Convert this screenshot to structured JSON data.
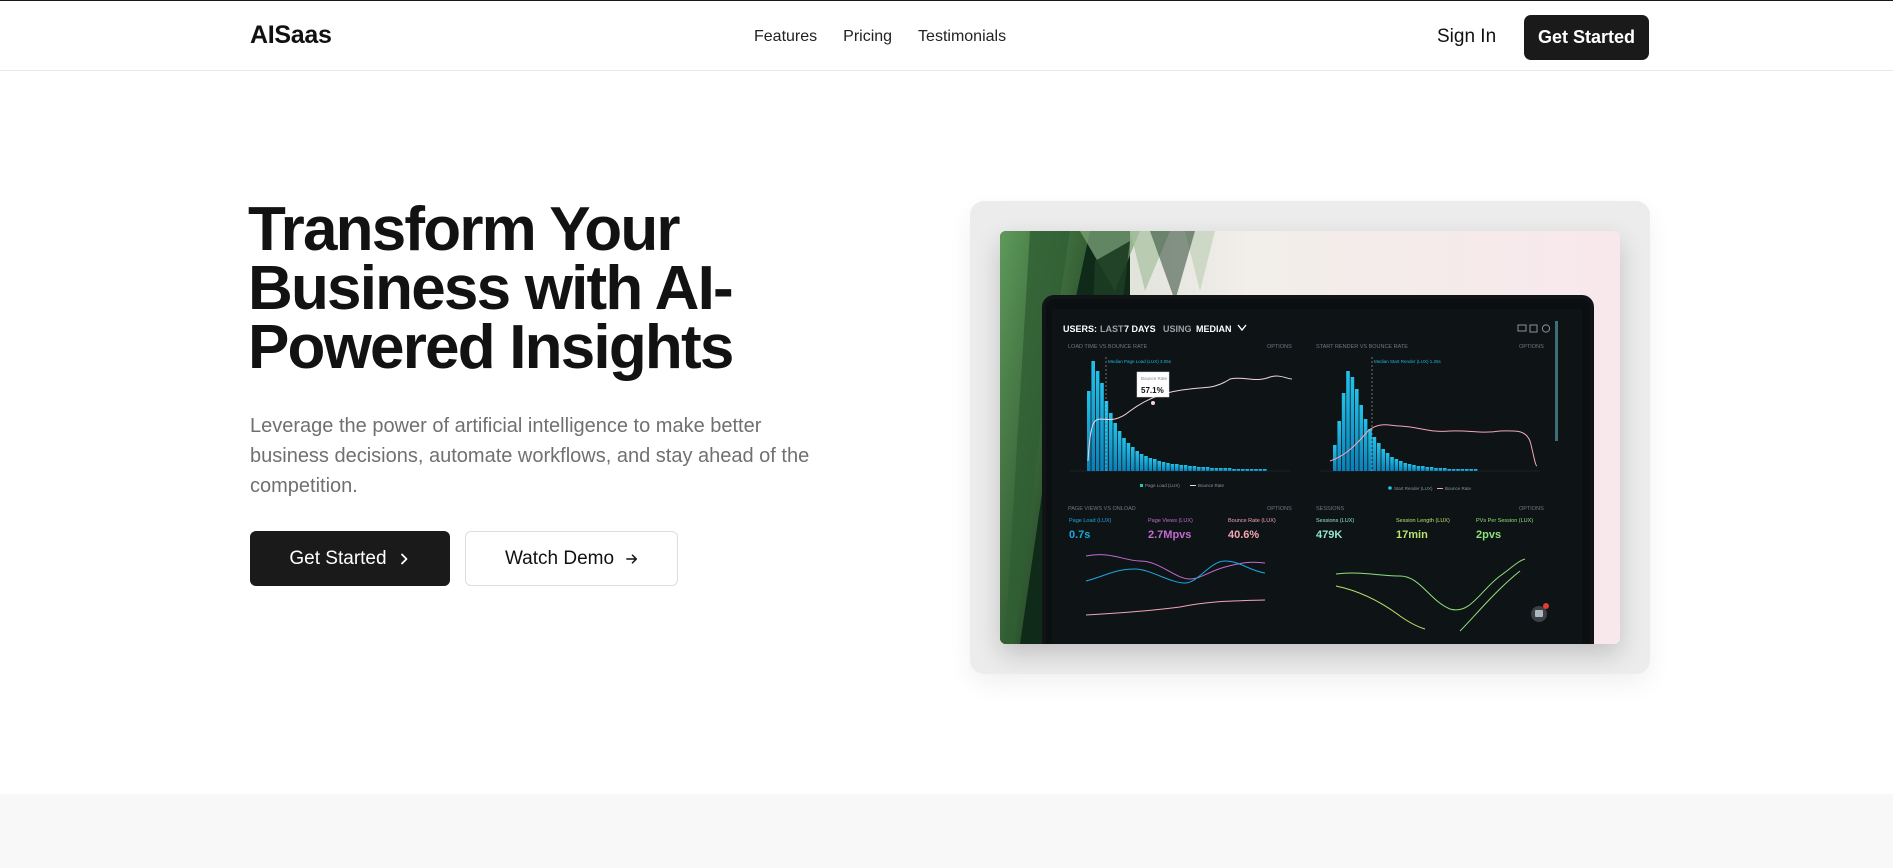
{
  "header": {
    "logo": "AISaas",
    "nav": [
      "Features",
      "Pricing",
      "Testimonials"
    ],
    "sign_in": "Sign In",
    "get_started": "Get Started"
  },
  "hero": {
    "title": "Transform Your Business with AI-Powered Insights",
    "subtitle": "Leverage the power of artificial intelligence to make better business decisions, automate workflows, and stay ahead of the competition.",
    "primary_button": "Get Started",
    "secondary_button": "Watch Demo"
  },
  "dashboard_image": {
    "title_prefix": "USERS:",
    "title_last": "LAST",
    "title_days": "7 DAYS",
    "title_using": "USING",
    "title_median": "MEDIAN",
    "panel1": "LOAD TIME VS BOUNCE RATE",
    "panel2": "START RENDER VS BOUNCE RATE",
    "options": "OPTIONS",
    "tooltip_label": "Bounce Rate",
    "tooltip_value": "57.1%",
    "median1": "Median Page Load (LUX) 3.05s",
    "median2": "Median Start Render (LUX) 1.25s",
    "legend1a": "Page Load (LUX)",
    "legend1b": "Bounce Rate",
    "legend2a": "Start Render (LUX)",
    "legend2b": "Bounce Rate",
    "panel3": "PAGE VIEWS VS ONLOAD",
    "panel4": "SESSIONS",
    "m1_label": "Page Load (LUX)",
    "m1_value": "0.7s",
    "m2_label": "Page Views (LUX)",
    "m2_value": "2.7Mpvs",
    "m3_label": "Bounce Rate (LUX)",
    "m3_value": "40.6%",
    "m4_label": "Sessions (LUX)",
    "m4_value": "479K",
    "m5_label": "Session Length (LUX)",
    "m5_value": "17min",
    "m6_label": "PVs Per Session (LUX)",
    "m6_value": "2pvs",
    "colors": {
      "cyan": "#1aa9e0",
      "pink": "#f3a6b4",
      "green": "#8fe27a",
      "purple": "#c26bd1"
    }
  },
  "colors": {
    "dark": "#1a1a1a",
    "muted_text": "#707070",
    "frame_bg": "#ececec"
  }
}
